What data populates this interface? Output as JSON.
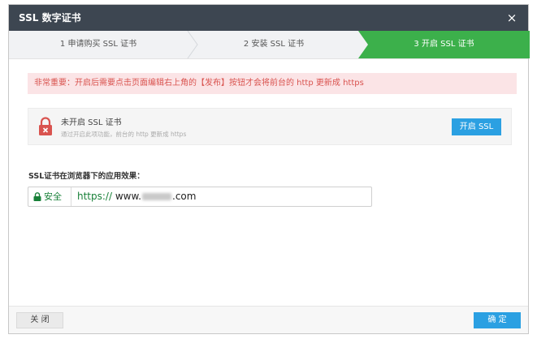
{
  "dialog": {
    "title": "SSL 数字证书",
    "close_symbol": "×"
  },
  "steps": [
    {
      "label": "1 申请购买 SSL 证书",
      "active": false
    },
    {
      "label": "2 安装 SSL 证书",
      "active": false
    },
    {
      "label": "3 开启 SSL 证书",
      "active": true
    }
  ],
  "notice": "非常重要：开启后需要点击页面编辑右上角的【发布】按钮才会将前台的 http 更新成 https",
  "status": {
    "title": "未开启 SSL 证书",
    "description": "通过开启此项功能，前台的 http 更新成 https",
    "button_label": "开启 SSL",
    "icon": "lock-icon"
  },
  "effect": {
    "label": "SSL证书在浏览器下的应用效果：",
    "secure_label": "安全",
    "url_scheme": "https://",
    "url_prefix": "www.",
    "url_suffix": ".com"
  },
  "footer": {
    "close_label": "关 闭",
    "confirm_label": "确 定"
  },
  "colors": {
    "titlebar": "#3d4651",
    "active_step": "#3cb04b",
    "accent_blue": "#2ba0e2",
    "notice_bg": "#fbe4e6",
    "notice_text": "#d9534f",
    "secure_green": "#188038",
    "lock_red": "#d9534f"
  }
}
